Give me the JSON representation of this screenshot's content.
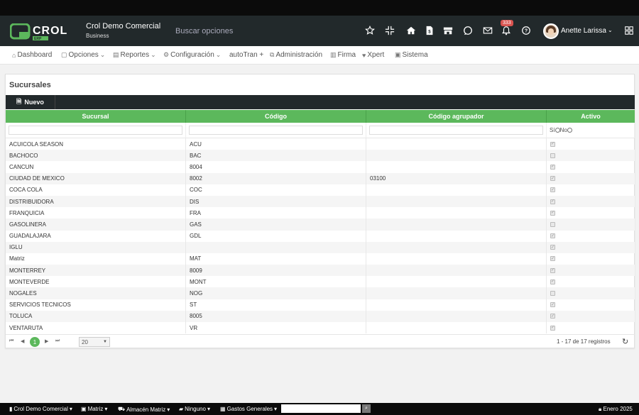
{
  "app": {
    "logo_text": "CROL ERP",
    "company": "Crol Demo Comercial",
    "company_sub": "Business",
    "search_placeholder": "Buscar opciones",
    "notifications_count": "333",
    "user_name": "Anette Larissa"
  },
  "menu": [
    {
      "label": "Dashboard",
      "icon": "home-icon"
    },
    {
      "label": "Opciones",
      "icon": "cube-icon"
    },
    {
      "label": "Reportes",
      "icon": "report-icon"
    },
    {
      "label": "Configuración",
      "icon": "gear-icon"
    },
    {
      "label": "autoTran +",
      "icon": ""
    },
    {
      "label": "Administración",
      "icon": "org-icon"
    },
    {
      "label": "Firma",
      "icon": "sign-icon"
    },
    {
      "label": "Xpert",
      "icon": "xpert-icon"
    },
    {
      "label": "Sistema",
      "icon": "system-icon"
    }
  ],
  "panel": {
    "title": "Sucursales",
    "new_button": "Nuevo"
  },
  "grid": {
    "columns": [
      "Sucursal",
      "Código",
      "Código agrupador",
      "Activo"
    ],
    "filter_active_yes": "Sí",
    "filter_active_no": "No",
    "rows": [
      {
        "sucursal": "ACUICOLA SEASON",
        "codigo": "ACU",
        "agrupador": "",
        "activo": true
      },
      {
        "sucursal": "BACHOCO",
        "codigo": "BAC",
        "agrupador": "",
        "activo": false
      },
      {
        "sucursal": "CANCUN",
        "codigo": "8004",
        "agrupador": "",
        "activo": true
      },
      {
        "sucursal": "CIUDAD DE MEXICO",
        "codigo": "8002",
        "agrupador": "03100",
        "activo": true
      },
      {
        "sucursal": "COCA COLA",
        "codigo": "COC",
        "agrupador": "",
        "activo": true
      },
      {
        "sucursal": "DISTRIBUIDORA",
        "codigo": "DIS",
        "agrupador": "",
        "activo": true
      },
      {
        "sucursal": "FRANQUICIA",
        "codigo": "FRA",
        "agrupador": "",
        "activo": true
      },
      {
        "sucursal": "GASOLINERA",
        "codigo": "GAS",
        "agrupador": "",
        "activo": false
      },
      {
        "sucursal": "GUADALAJARA",
        "codigo": "GDL",
        "agrupador": "",
        "activo": true
      },
      {
        "sucursal": "IGLU",
        "codigo": "",
        "agrupador": "",
        "activo": true
      },
      {
        "sucursal": "Matriz",
        "codigo": "MAT",
        "agrupador": "",
        "activo": true
      },
      {
        "sucursal": "MONTERREY",
        "codigo": "8009",
        "agrupador": "",
        "activo": true
      },
      {
        "sucursal": "MONTEVERDE",
        "codigo": "MONT",
        "agrupador": "",
        "activo": true
      },
      {
        "sucursal": "NOGALES",
        "codigo": "NOG",
        "agrupador": "",
        "activo": false
      },
      {
        "sucursal": "SERVICIOS TECNICOS",
        "codigo": "ST",
        "agrupador": "",
        "activo": true
      },
      {
        "sucursal": "TOLUCA",
        "codigo": "8005",
        "agrupador": "",
        "activo": true
      },
      {
        "sucursal": "VENTARUTA",
        "codigo": "VR",
        "agrupador": "",
        "activo": true
      }
    ]
  },
  "pager": {
    "current_page": "1",
    "page_size": "20",
    "records": "1 - 17 de 17 registros"
  },
  "footer": {
    "company": "Crol Demo Comercial",
    "branch": "Matriz",
    "warehouse": "Almacén Matriz",
    "other": "Ninguno",
    "expenses": "Gastos Generales",
    "date": "Enero 2025"
  },
  "colors": {
    "header_bg": "#22292b",
    "grid_header": "#5cb85c",
    "logo_green": "#5cb85c"
  }
}
